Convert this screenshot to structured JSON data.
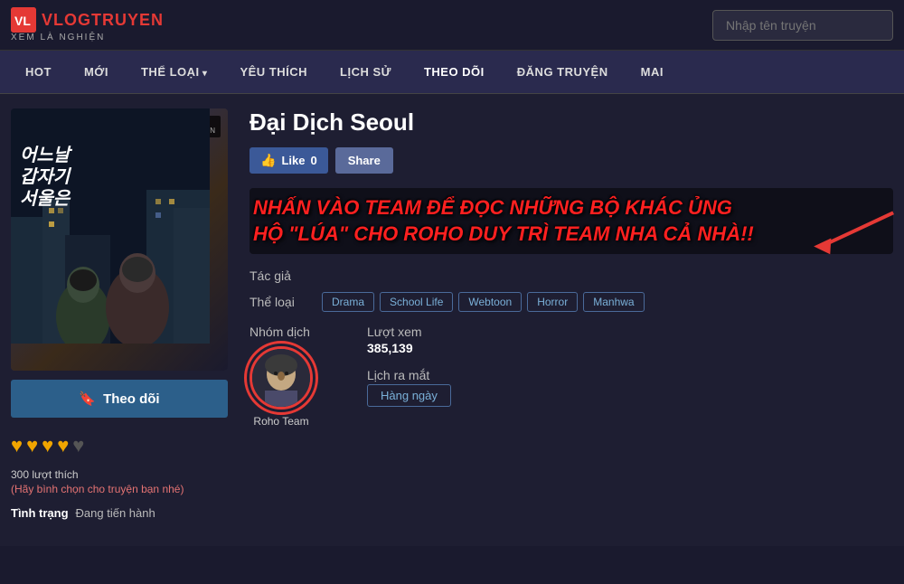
{
  "header": {
    "logo_main": "VLOGTRUYEN",
    "logo_sub": "XEM LÀ NGHIỆN",
    "logo_icon": "V",
    "search_placeholder": "Nhập tên truyện"
  },
  "nav": {
    "items": [
      {
        "label": "HOT",
        "active": false,
        "has_arrow": false
      },
      {
        "label": "MỚI",
        "active": false,
        "has_arrow": false
      },
      {
        "label": "THỂ LOẠI",
        "active": false,
        "has_arrow": true
      },
      {
        "label": "YÊU THÍCH",
        "active": false,
        "has_arrow": false
      },
      {
        "label": "LỊCH SỬ",
        "active": false,
        "has_arrow": false
      },
      {
        "label": "THEO DÕI",
        "active": true,
        "has_arrow": false
      },
      {
        "label": "ĐĂNG TRUYỆN",
        "active": false,
        "has_arrow": false
      },
      {
        "label": "MAI",
        "active": false,
        "has_arrow": false
      }
    ]
  },
  "manga": {
    "title": "Đại Dịch Seoul",
    "cover_text": "어느날\n갑자기\n서울은",
    "roho_label": "ROHO\nTEAM",
    "vlogtruyen_watermark": "VLOGTRUYEN\nXEM LÀ NGHIỆN",
    "like_label": "Like",
    "like_count": "0",
    "share_label": "Share",
    "promo_text": "NHẤN VÀO TEAM ĐỂ ĐỌC NHỮNG BỘ KHÁC ỦNG HỘ \"LÚA\" CHO ROHO DUY TRÌ TEAM NHA CẢ NHÀ!!",
    "tac_gia_label": "Tác giả",
    "tac_gia_value": "",
    "the_loai_label": "Thể loại",
    "genres": [
      "Drama",
      "School Life",
      "Webtoon",
      "Horror",
      "Manhwa"
    ],
    "nhom_dich_label": "Nhóm dịch",
    "group_name": "Roho Team",
    "luot_xem_label": "Lượt xem",
    "luot_xem_value": "385,139",
    "lich_ra_mat_label": "Lịch ra mắt",
    "lich_ra_mat_value": "Hàng ngày",
    "follow_label": "Theo dõi",
    "vote_count_text": "300 lượt thích",
    "vote_prompt": "(Hãy bình chọn cho truyện bạn nhé)",
    "tinh_trang_label": "Tình trạng",
    "tinh_trang_value": "Đang tiến hành"
  }
}
